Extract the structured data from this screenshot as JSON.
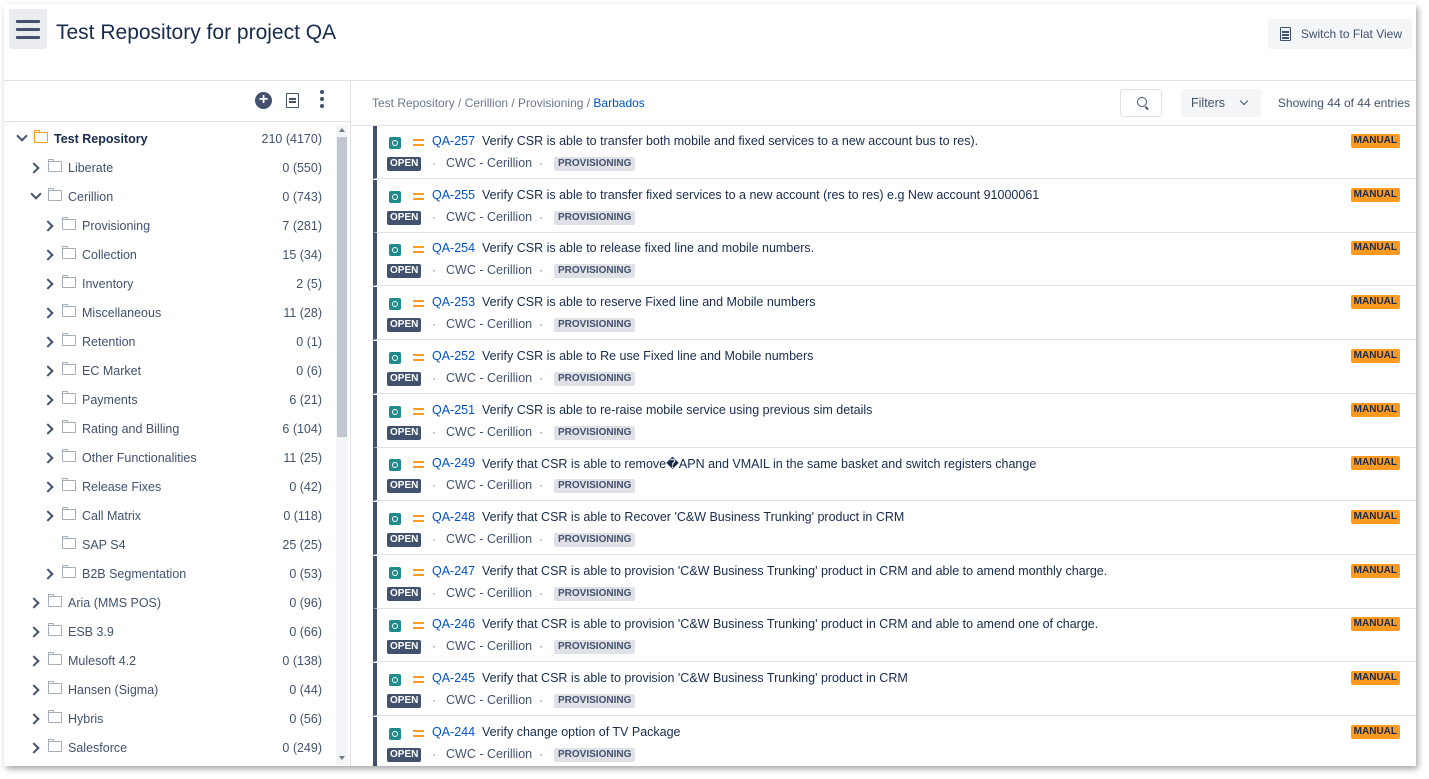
{
  "header": {
    "title": "Test Repository for project QA",
    "flat_view_label": "Switch to Flat View"
  },
  "tree": {
    "items": [
      {
        "label": "Test Repository",
        "count": "210 (4170)",
        "level": 0,
        "expanded": true,
        "bold": true,
        "root": true
      },
      {
        "label": "Liberate",
        "count": "0 (550)",
        "level": 1,
        "expanded": false
      },
      {
        "label": "Cerillion",
        "count": "0 (743)",
        "level": 1,
        "expanded": true
      },
      {
        "label": "Provisioning",
        "count": "7 (281)",
        "level": 2,
        "expanded": false
      },
      {
        "label": "Collection",
        "count": "15 (34)",
        "level": 2,
        "expanded": false
      },
      {
        "label": "Inventory",
        "count": "2 (5)",
        "level": 2,
        "expanded": false
      },
      {
        "label": "Miscellaneous",
        "count": "11 (28)",
        "level": 2,
        "expanded": false
      },
      {
        "label": "Retention",
        "count": "0 (1)",
        "level": 2,
        "expanded": false
      },
      {
        "label": "EC Market",
        "count": "0 (6)",
        "level": 2,
        "expanded": false
      },
      {
        "label": "Payments",
        "count": "6 (21)",
        "level": 2,
        "expanded": false
      },
      {
        "label": "Rating and Billing",
        "count": "6 (104)",
        "level": 2,
        "expanded": false
      },
      {
        "label": "Other Functionalities",
        "count": "11 (25)",
        "level": 2,
        "expanded": false
      },
      {
        "label": "Release Fixes",
        "count": "0 (42)",
        "level": 2,
        "expanded": false
      },
      {
        "label": "Call Matrix",
        "count": "0 (118)",
        "level": 2,
        "expanded": false
      },
      {
        "label": "SAP S4",
        "count": "25 (25)",
        "level": 2,
        "leaf": true
      },
      {
        "label": "B2B Segmentation",
        "count": "0 (53)",
        "level": 2,
        "expanded": false
      },
      {
        "label": "Aria (MMS POS)",
        "count": "0 (96)",
        "level": 1,
        "expanded": false
      },
      {
        "label": "ESB 3.9",
        "count": "0 (66)",
        "level": 1,
        "expanded": false
      },
      {
        "label": "Mulesoft 4.2",
        "count": "0 (138)",
        "level": 1,
        "expanded": false
      },
      {
        "label": "Hansen (Sigma)",
        "count": "0 (44)",
        "level": 1,
        "expanded": false
      },
      {
        "label": "Hybris",
        "count": "0 (56)",
        "level": 1,
        "expanded": false
      },
      {
        "label": "Salesforce",
        "count": "0 (249)",
        "level": 1,
        "expanded": false
      }
    ]
  },
  "breadcrumb": {
    "path": "Test Repository / Cerillion / Provisioning / ",
    "current": "Barbados"
  },
  "toolbar": {
    "filters_label": "Filters",
    "showing": "Showing 44 of 44 entries"
  },
  "issues": [
    {
      "key": "QA-257",
      "summary": "Verify CSR is able to transfer both mobile and fixed services to a new account bus to res).",
      "status": "OPEN",
      "component": "CWC - Cerillion",
      "label": "PROVISIONING",
      "type": "MANUAL"
    },
    {
      "key": "QA-255",
      "summary": "Verify CSR is able to transfer fixed services to a new account (res to res) e.g New account 91000061",
      "status": "OPEN",
      "component": "CWC - Cerillion",
      "label": "PROVISIONING",
      "type": "MANUAL"
    },
    {
      "key": "QA-254",
      "summary": "Verify CSR is able to release fixed line and mobile numbers.",
      "status": "OPEN",
      "component": "CWC - Cerillion",
      "label": "PROVISIONING",
      "type": "MANUAL"
    },
    {
      "key": "QA-253",
      "summary": "Verify CSR is able to reserve Fixed line and Mobile numbers",
      "status": "OPEN",
      "component": "CWC - Cerillion",
      "label": "PROVISIONING",
      "type": "MANUAL"
    },
    {
      "key": "QA-252",
      "summary": "Verify CSR is able to Re use Fixed line and Mobile numbers",
      "status": "OPEN",
      "component": "CWC - Cerillion",
      "label": "PROVISIONING",
      "type": "MANUAL"
    },
    {
      "key": "QA-251",
      "summary": "Verify CSR is able to re-raise mobile service using previous sim details",
      "status": "OPEN",
      "component": "CWC - Cerillion",
      "label": "PROVISIONING",
      "type": "MANUAL"
    },
    {
      "key": "QA-249",
      "summary": "Verify that CSR is able to remove�APN and VMAIL in the same basket and switch registers change",
      "status": "OPEN",
      "component": "CWC - Cerillion",
      "label": "PROVISIONING",
      "type": "MANUAL"
    },
    {
      "key": "QA-248",
      "summary": "Verify that CSR is able to Recover 'C&W Business Trunking' product in CRM",
      "status": "OPEN",
      "component": "CWC - Cerillion",
      "label": "PROVISIONING",
      "type": "MANUAL"
    },
    {
      "key": "QA-247",
      "summary": "Verify that CSR is able to provision 'C&W Business Trunking' product in CRM and able to amend monthly charge.",
      "status": "OPEN",
      "component": "CWC - Cerillion",
      "label": "PROVISIONING",
      "type": "MANUAL"
    },
    {
      "key": "QA-246",
      "summary": "Verify that CSR is able to provision 'C&W Business Trunking' product in CRM and able to amend one of charge.",
      "status": "OPEN",
      "component": "CWC - Cerillion",
      "label": "PROVISIONING",
      "type": "MANUAL"
    },
    {
      "key": "QA-245",
      "summary": "Verify that CSR is able to provision 'C&W Business Trunking' product in CRM",
      "status": "OPEN",
      "component": "CWC - Cerillion",
      "label": "PROVISIONING",
      "type": "MANUAL"
    },
    {
      "key": "QA-244",
      "summary": "Verify change option of TV Package",
      "status": "OPEN",
      "component": "CWC - Cerillion",
      "label": "PROVISIONING",
      "type": "MANUAL"
    }
  ],
  "icons": {
    "menu": "hamburger-icon",
    "flat_view": "list-icon",
    "add": "plus-circle-icon",
    "doc": "document-icon",
    "more": "vertical-ellipsis-icon",
    "search": "search-icon",
    "issue_type": "test-icon",
    "priority": "medium-priority-icon"
  },
  "colors": {
    "accent": "#0052cc",
    "status_open": "#42526e",
    "manual_badge": "#ff991f",
    "root_folder": "#ff991f"
  }
}
